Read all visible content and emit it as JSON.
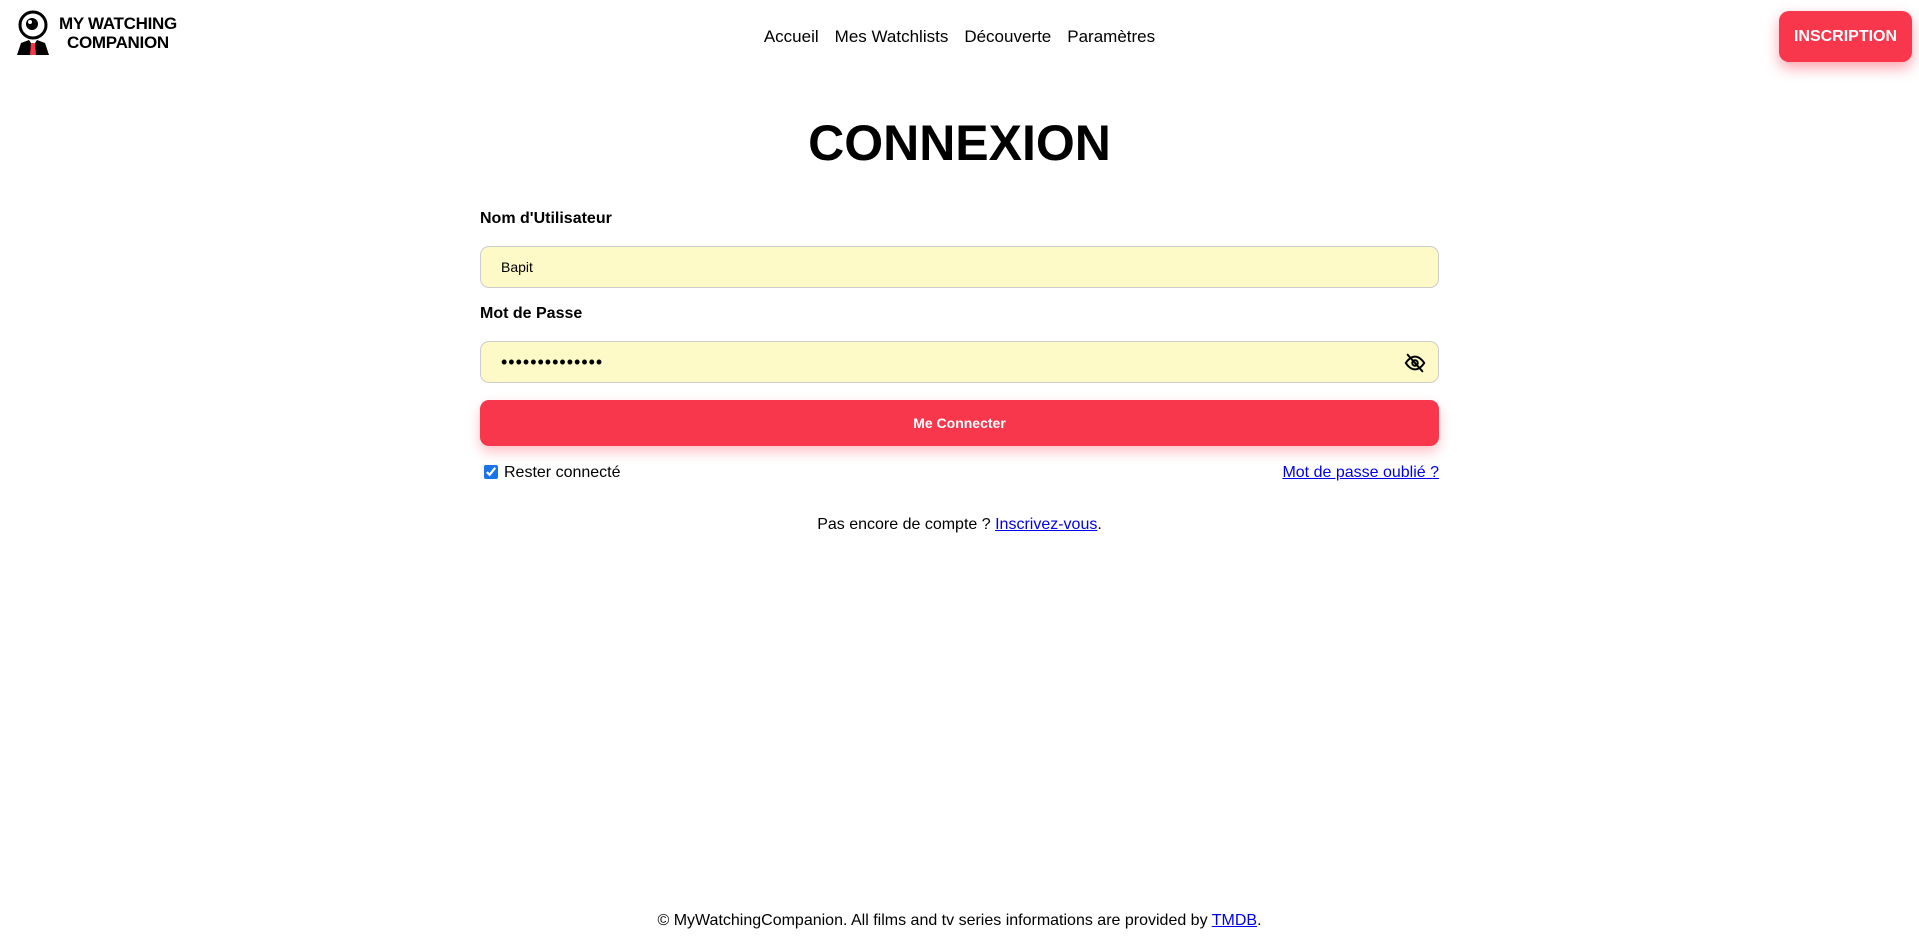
{
  "header": {
    "logo_text_line1": "MY WATCHING",
    "logo_text_line2": "COMPANION",
    "nav": [
      "Accueil",
      "Mes Watchlists",
      "Découverte",
      "Paramètres"
    ],
    "signup_label": "INSCRIPTION"
  },
  "login": {
    "title": "CONNEXION",
    "username_label": "Nom d'Utilisateur",
    "username_value": "Bapit",
    "password_label": "Mot de Passe",
    "password_value": "••••••••••••••",
    "submit_label": "Me Connecter",
    "remember_label": "Rester connecté",
    "remember_checked": true,
    "forgot_label": "Mot de passe oublié ?",
    "no_account_text": "Pas encore de compte ? ",
    "signup_link": "Inscrivez-vous",
    "period": "."
  },
  "footer": {
    "text": "© MyWatchingCompanion. All films and tv series informations are provided by ",
    "tmdb_link": "TMDB",
    "period": "."
  },
  "colors": {
    "accent": "#f8364c",
    "input_bg": "#fefac7"
  }
}
